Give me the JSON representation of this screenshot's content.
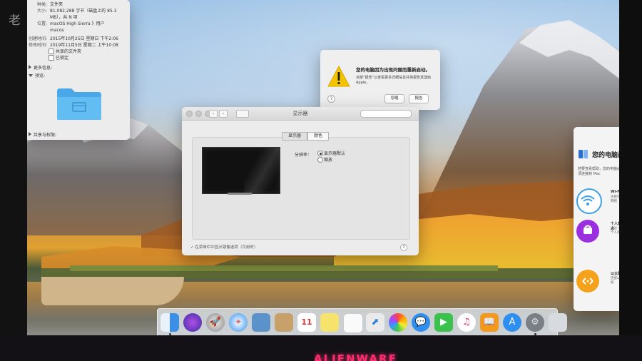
{
  "watermark": "老",
  "brand": "ALIENWARE",
  "info_panel": {
    "rows": [
      {
        "k": "种类:",
        "v": "文件夹"
      },
      {
        "k": "大小:",
        "v": "81,082,288 字节（磁盘上的 85.3"
      },
      {
        "k": "",
        "v": "MB），共 N 项"
      },
      {
        "k": "位置:",
        "v": "macOS High Sierra 》用户"
      },
      {
        "k": "",
        "v": "macos"
      },
      {
        "k": "创建时间:",
        "v": "2015年10月25日 星期日 下午2:06"
      },
      {
        "k": "修改时间:",
        "v": "2019年11月5日 星期二 上午10:08"
      }
    ],
    "shared_folder": "共享的文件夹",
    "locked": "已锁定",
    "more_info": "更多信息:",
    "preview": "预览:",
    "sharing": "共享与权限:"
  },
  "alert": {
    "title": "您的电脑因为出现问题而重新启动。",
    "body": "点按“报告”以查看更多详细信息并将报告发送给 Apple。",
    "ignore": "忽略",
    "report": "报告",
    "help": "?"
  },
  "display_prefs": {
    "title": "显示器",
    "tab_display": "显示器",
    "tab_color": "颜色",
    "resolution_label": "分辨率：",
    "option_default": "显示器默认",
    "option_scaled": "缩放",
    "mirror_option": "在菜单栏中显示镜像选项（可用时）",
    "help": "?",
    "back": "‹",
    "forward": "›"
  },
  "setup": {
    "title": "您的电脑尚未重",
    "subtitle": "若要查看帮助，您的电脑必须连接到 Mac",
    "items": [
      {
        "title": "Wi-Fi",
        "desc": "连接到 Wi-Fi 网络"
      },
      {
        "title": "个人热点",
        "desc": "通过 iPhone 个人热点连接"
      },
      {
        "title": "以太网",
        "desc": "连接以太网线缆"
      }
    ]
  },
  "dock": {
    "calendar_day": "11"
  },
  "colors": {
    "accent": "#1f74e6",
    "warning": "#f5c400",
    "brand_glow": "#ff2d6f"
  }
}
